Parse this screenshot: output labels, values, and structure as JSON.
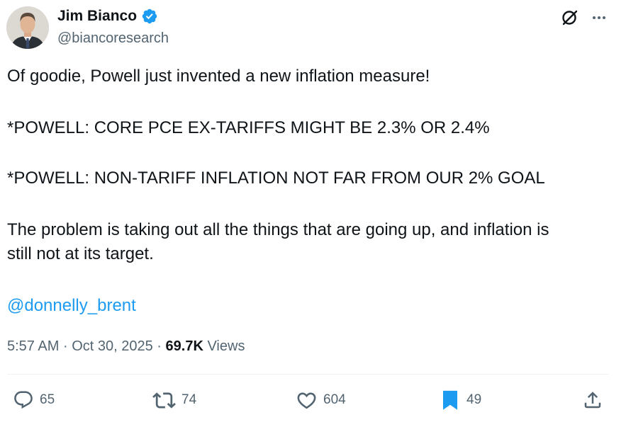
{
  "author": {
    "name": "Jim Bianco",
    "handle": "@biancoresearch",
    "verified": true
  },
  "tweet": {
    "lines": [
      "Of goodie, Powell just invented a new inflation measure!",
      "*POWELL: CORE PCE EX-TARIFFS MIGHT BE 2.3% OR 2.4%",
      "*POWELL: NON-TARIFF INFLATION NOT FAR FROM OUR 2% GOAL",
      "The problem is taking out all the things that are going up, and inflation is",
      "still not at its target."
    ],
    "mention": "@donnelly_brent"
  },
  "meta": {
    "time": "5:57 AM",
    "separator": "·",
    "date": "Oct 30, 2025",
    "views_count": "69.7K",
    "views_label": "Views"
  },
  "actions": {
    "replies": "65",
    "reposts": "74",
    "likes": "604",
    "bookmarks": "49"
  },
  "colors": {
    "accent": "#1d9bf0",
    "secondary_text": "#536471",
    "primary_text": "#0f1419",
    "verified_badge": "#1d9bf0"
  },
  "icons": {
    "header": [
      "grok-icon",
      "more-icon"
    ],
    "actions": [
      "reply-icon",
      "repost-icon",
      "like-icon",
      "bookmark-icon",
      "share-icon"
    ]
  }
}
